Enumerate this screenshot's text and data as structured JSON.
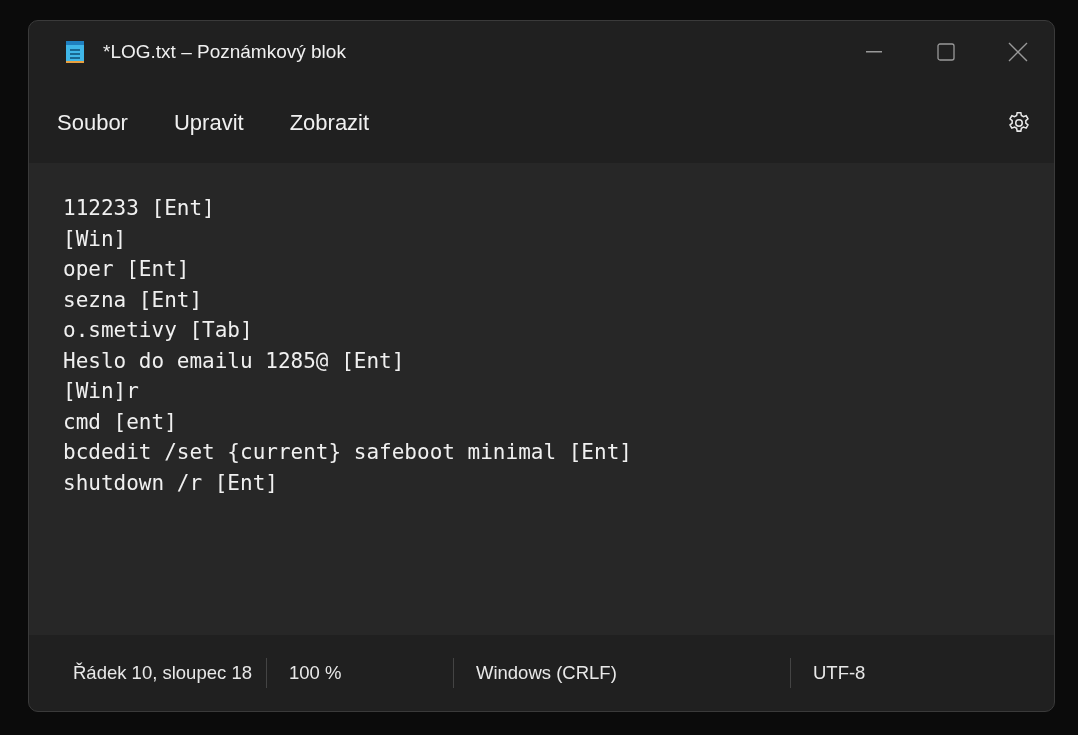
{
  "window": {
    "title": "*LOG.txt – Poznámkový blok"
  },
  "menu": [
    "Soubor",
    "Upravit",
    "Zobrazit"
  ],
  "editor": {
    "lines": [
      "112233 [Ent]",
      "[Win]",
      "oper [Ent]",
      "sezna [Ent]",
      "o.smetivy [Tab]",
      "Heslo do emailu 1285@ [Ent]",
      "[Win]r",
      "cmd [ent]",
      "bcdedit /set {current} safeboot minimal [Ent]",
      "shutdown /r [Ent]"
    ]
  },
  "status_bar": [
    "Řádek 10, sloupec 18",
    "100 %",
    "Windows (CRLF)",
    "UTF-8"
  ]
}
